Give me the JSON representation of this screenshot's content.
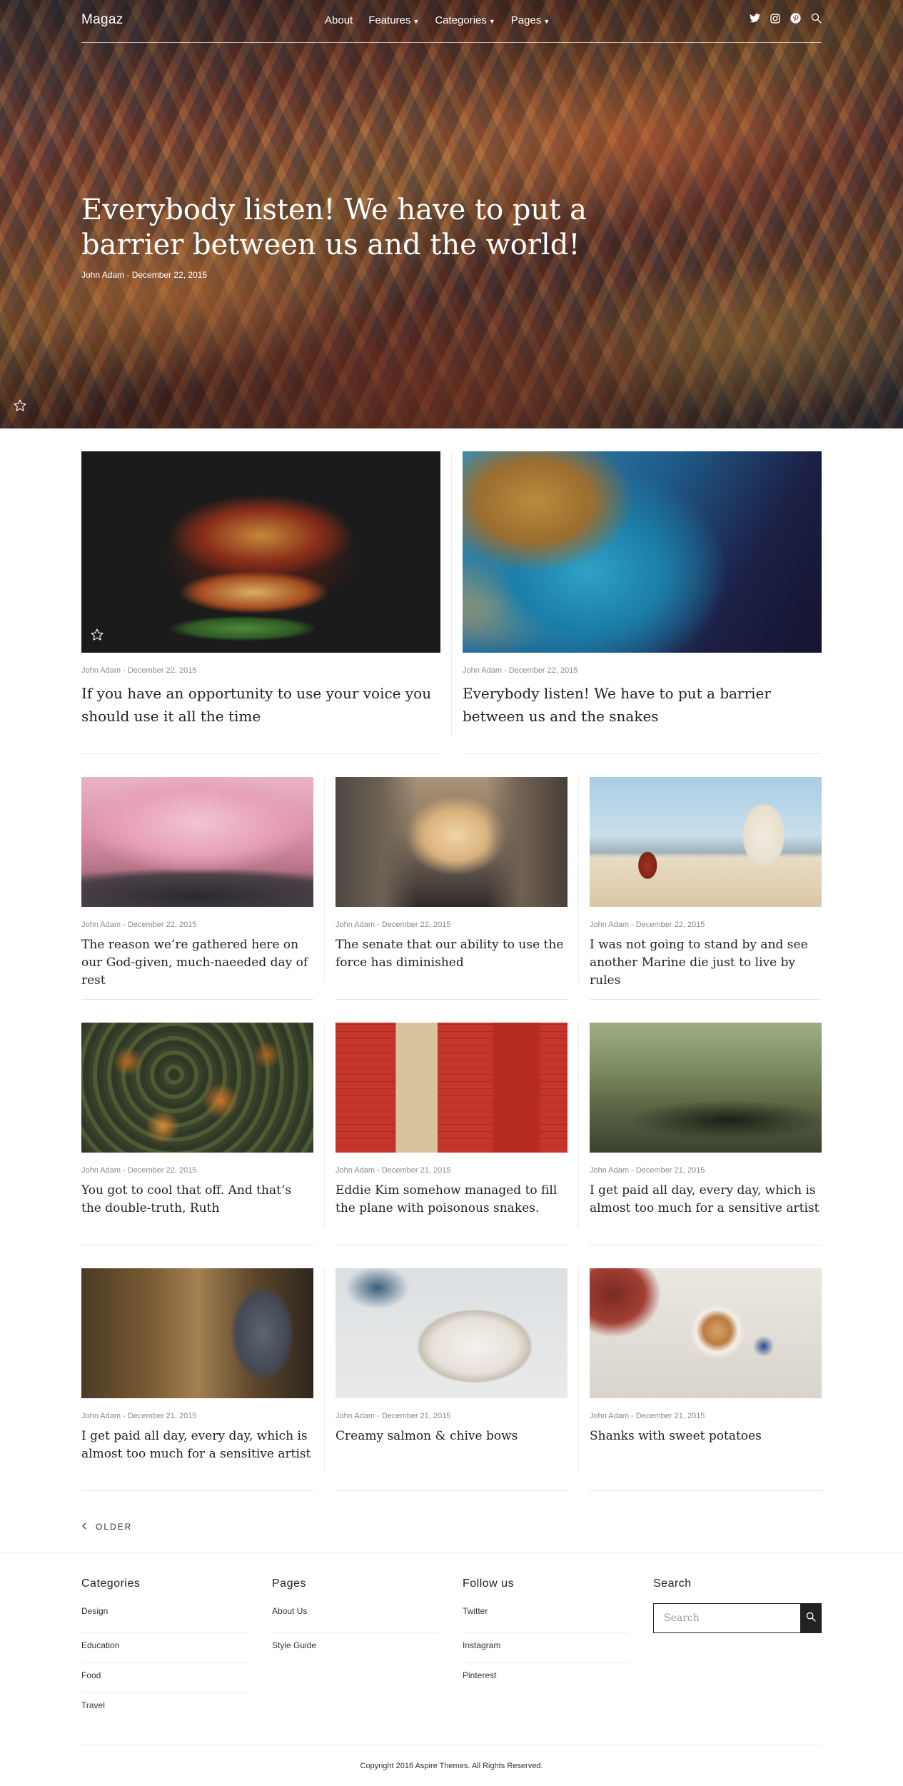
{
  "site": {
    "logo": "Magaz",
    "nav": [
      {
        "label": "About",
        "dropdown": false
      },
      {
        "label": "Features",
        "dropdown": true
      },
      {
        "label": "Categories",
        "dropdown": true
      },
      {
        "label": "Pages",
        "dropdown": true
      }
    ],
    "social_icons": [
      "twitter-icon",
      "instagram-icon",
      "pinterest-icon",
      "search-icon"
    ]
  },
  "hero": {
    "title": "Everybody listen! We have to put a barrier between us and the world!",
    "meta": "John Adam - December 22, 2015"
  },
  "featured": [
    {
      "meta": "John Adam - December 22, 2015",
      "title": "If you have an opportunity to use your voice you should use it all the time"
    },
    {
      "meta": "John Adam - December 22, 2015",
      "title": "Everybody listen! We have to put a barrier between us and the snakes"
    }
  ],
  "grid": [
    {
      "meta": "John Adam - December 22, 2015",
      "title": "The reason we’re gathered here on our God-given, much-naeeded day of rest"
    },
    {
      "meta": "John Adam - December 22, 2015",
      "title": "The senate that our ability to use the force has diminished"
    },
    {
      "meta": "John Adam - December 22, 2015",
      "title": "I was not going to stand by and see another Marine die just to live by rules"
    },
    {
      "meta": "John Adam - December 22, 2015",
      "title": "You got to cool that off. And that’s the double-truth, Ruth"
    },
    {
      "meta": "John Adam - December 21, 2015",
      "title": "Eddie Kim somehow managed to fill the plane with poisonous snakes."
    },
    {
      "meta": "John Adam - December 21, 2015",
      "title": "I get paid all day, every day, which is almost too much for a sensitive artist"
    },
    {
      "meta": "John Adam - December 21, 2015",
      "title": "I get paid all day, every day, which is almost too much for a sensitive artist"
    },
    {
      "meta": "John Adam - December 21, 2015",
      "title": "Creamy salmon & chive bows"
    },
    {
      "meta": "John Adam - December 21, 2015",
      "title": "Shanks with sweet potatoes"
    }
  ],
  "pagination": {
    "older_label": "OLDER"
  },
  "footer": {
    "categories": {
      "heading": "Categories",
      "items": [
        "Design",
        "Education",
        "Food",
        "Travel"
      ]
    },
    "pages": {
      "heading": "Pages",
      "items": [
        "About Us",
        "Style Guide"
      ]
    },
    "follow": {
      "heading": "Follow us",
      "items": [
        "Twitter",
        "Instagram",
        "Pinterest"
      ]
    },
    "search": {
      "heading": "Search",
      "placeholder": "Search"
    },
    "copyright": "Copyright 2016 Aspire Themes. All Rights Reserved."
  }
}
